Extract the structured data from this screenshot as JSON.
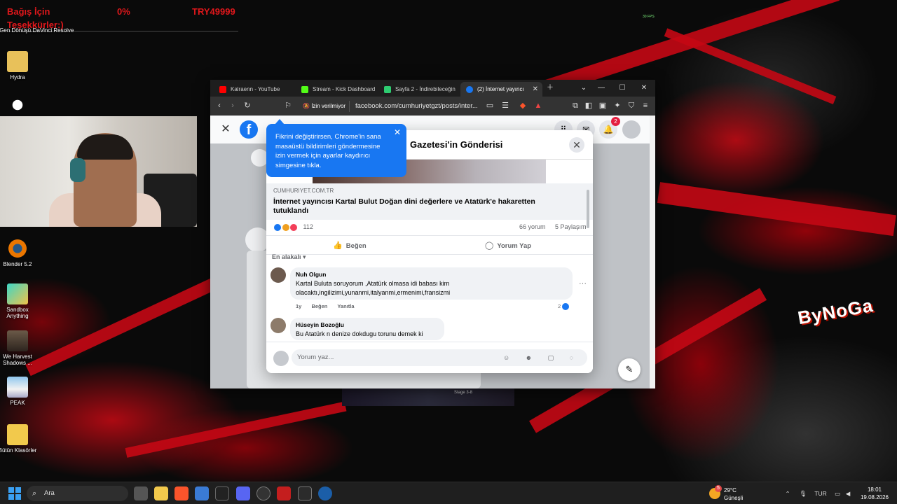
{
  "overlay": {
    "donation_label": "Bağış İçin",
    "thanks_label": "Teşekkürler:)",
    "percent": "0%",
    "goal": "TRY49999",
    "fps": "30 FPS"
  },
  "desktop_icons": [
    {
      "label": "Gen Dönüşü..."
    },
    {
      "label": "DaVinci Resolve"
    },
    {
      "label": "Hydra"
    },
    {
      "label": "Blender 5.2"
    },
    {
      "label": "Sandbox Anything"
    },
    {
      "label": "We Harvest Shadows ..."
    },
    {
      "label": "PEAK"
    },
    {
      "label": "Bütün Klasörler"
    }
  ],
  "watermark": "ByNoGa",
  "browser": {
    "tabs": [
      {
        "label": "Kalraenn - YouTube",
        "color": "#ff0000",
        "active": false
      },
      {
        "label": "Stream - Kick Dashboard",
        "color": "#53fc18",
        "active": false
      },
      {
        "label": "Sayfa 2 - İndirebileceğin",
        "color": "#2ecc71",
        "active": false
      },
      {
        "label": "(2) İnternet yayıncı",
        "color": "#1877f2",
        "active": true
      }
    ],
    "permission_label": "İzin verilmiyor",
    "url": "facebook.com/cumhuriyetgzt/posts/inter..."
  },
  "facebook": {
    "notification_count": "2",
    "tooltip": "Fikrini değiştirirsen, Chrome'in sana masaüstü bildirimleri göndermesine izin vermek için ayarlar kaydırıcı simgesine tıkla.",
    "modal_title": "Gazetesi'in Gönderisi",
    "link_domain": "CUMHURIYET.COM.TR",
    "link_title": "İnternet yayıncısı Kartal Bulut Doğan dini değerlere ve Atatürk'e hakaretten tutuklandı",
    "reaction_count": "112",
    "comments_count": "66 yorum",
    "shares_count": "5 Paylaşım",
    "like_label": "Beğen",
    "comment_label": "Yorum Yap",
    "sort_label": "En alakalı",
    "comments": [
      {
        "author": "Nuh Olgun",
        "text": "Kartal Buluta soruyorum ,Atatürk olmasa idi babası kim olacaktı,ingilizimi,yunanmi,italyanmi,ermenimi,fransizmi",
        "time": "1y",
        "like": "Beğen",
        "reply": "Yanıtla",
        "likes": "2"
      },
      {
        "author": "Hüseyin Bozoğlu",
        "text": "Bu Atatürk n denize dokdugu torunu demek ki"
      }
    ],
    "composer_placeholder": "Yorum yaz..."
  },
  "game": {
    "stage": "Stage 3-8"
  },
  "taskbar": {
    "search_placeholder": "Ara",
    "weather_temp": "29°C",
    "weather_desc": "Güneşli",
    "weather_badge": "5",
    "language": "TUR",
    "time": "18:01",
    "date": "19.08.2026"
  }
}
